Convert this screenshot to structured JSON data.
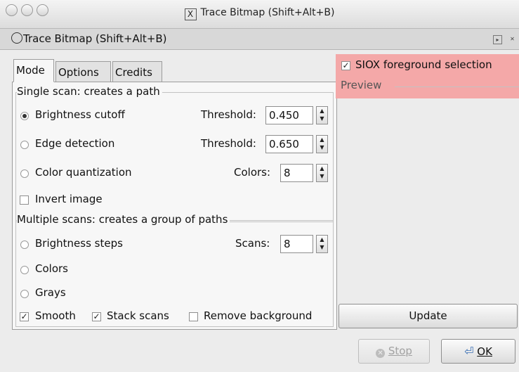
{
  "window": {
    "title": "Trace Bitmap (Shift+Alt+B)",
    "x11_glyph": "X"
  },
  "dock": {
    "title": "Trace Bitmap (Shift+Alt+B)",
    "btn_float": "▸",
    "btn_close": "✕"
  },
  "tabs": [
    {
      "label": "Mode",
      "active": true
    },
    {
      "label": "Options",
      "active": false
    },
    {
      "label": "Credits",
      "active": false
    }
  ],
  "single_scan": {
    "header": "Single scan: creates a path",
    "brightness": {
      "label": "Brightness cutoff",
      "param": "Threshold:",
      "value": "0.450",
      "selected": true
    },
    "edge": {
      "label": "Edge detection",
      "param": "Threshold:",
      "value": "0.650",
      "selected": false
    },
    "color_quant": {
      "label": "Color quantization",
      "param": "Colors:",
      "value": "8",
      "selected": false
    },
    "invert": {
      "label": "Invert image",
      "checked": false
    }
  },
  "multi_scan": {
    "header": "Multiple scans: creates a group of paths",
    "brightness_steps": {
      "label": "Brightness steps",
      "param": "Scans:",
      "value": "8",
      "selected": false
    },
    "colors": {
      "label": "Colors",
      "selected": false
    },
    "grays": {
      "label": "Grays",
      "selected": false
    }
  },
  "options_row": {
    "smooth": {
      "label": "Smooth",
      "checked": true
    },
    "stack": {
      "label": "Stack scans",
      "checked": true
    },
    "remove_bg": {
      "label": "Remove background",
      "checked": false
    }
  },
  "right": {
    "siox_label": "SIOX foreground selection",
    "siox_checked": true,
    "preview_label": "Preview",
    "update_label": "Update",
    "highlight_color": "#f4a8a8"
  },
  "footer": {
    "stop_label": "Stop",
    "ok_label": "OK"
  },
  "glyphs": {
    "check": "✓",
    "spin_up": "▲",
    "spin_down": "▼"
  }
}
